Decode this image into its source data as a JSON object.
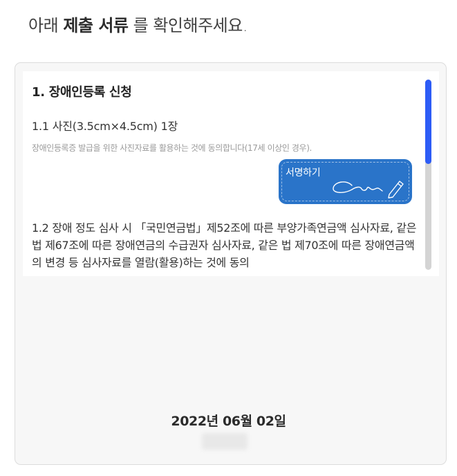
{
  "heading": {
    "prefix": "아래",
    "emphasis": "제출 서류",
    "suffix": "를 확인해주세요."
  },
  "document": {
    "section_title": "1. 장애인등록 신청",
    "item1": {
      "title": "1.1 사진(3.5cm×4.5cm) 1장",
      "description": "장애인등록증 발급을 위한 사진자료를 활용하는 것에 동의합니다(17세 이상인 경우).",
      "sign_button_label": "서명하기"
    },
    "item2": {
      "text": "1.2 장애 정도 심사 시 「국민연금법」제52조에 따른 부양가족연금액 심사자료, 같은 법 제67조에 따른 장애연금의 수급권자 심사자료, 같은 법 제70조에 따른 장애연금액의 변경 등 심사자료를 열람(활용)하는 것에 동의"
    }
  },
  "footer": {
    "date": "2022년 06월 02일"
  },
  "colors": {
    "sign_button": "#2a74c9",
    "scroll_thumb": "#2d5cf6"
  }
}
